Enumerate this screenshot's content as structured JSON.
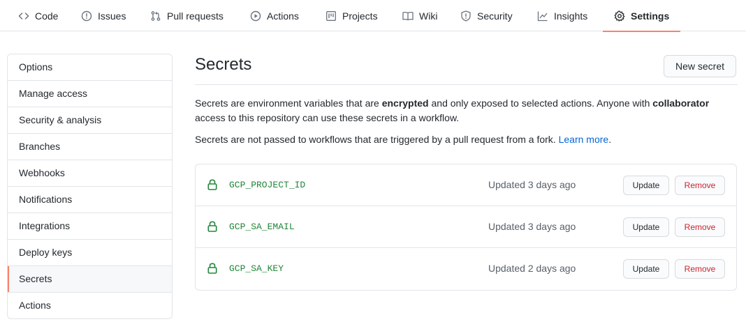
{
  "nav": {
    "tabs": [
      {
        "label": "Code",
        "icon": "code-icon"
      },
      {
        "label": "Issues",
        "icon": "issue-icon"
      },
      {
        "label": "Pull requests",
        "icon": "pull-request-icon"
      },
      {
        "label": "Actions",
        "icon": "play-icon"
      },
      {
        "label": "Projects",
        "icon": "project-icon"
      },
      {
        "label": "Wiki",
        "icon": "book-icon"
      },
      {
        "label": "Security",
        "icon": "shield-icon"
      },
      {
        "label": "Insights",
        "icon": "graph-icon"
      },
      {
        "label": "Settings",
        "icon": "gear-icon"
      }
    ],
    "selected": "Settings"
  },
  "sidebar": {
    "items": [
      {
        "label": "Options"
      },
      {
        "label": "Manage access"
      },
      {
        "label": "Security & analysis"
      },
      {
        "label": "Branches"
      },
      {
        "label": "Webhooks"
      },
      {
        "label": "Notifications"
      },
      {
        "label": "Integrations"
      },
      {
        "label": "Deploy keys"
      },
      {
        "label": "Secrets"
      },
      {
        "label": "Actions"
      }
    ],
    "selected": "Secrets"
  },
  "main": {
    "title": "Secrets",
    "new_button": "New secret",
    "desc1": {
      "a": "Secrets are environment variables that are ",
      "b": "encrypted",
      "c": " and only exposed to selected actions. Anyone with ",
      "d": "collaborator",
      "e": " access to this repository can use these secrets in a workflow."
    },
    "desc2": {
      "a": "Secrets are not passed to workflows that are triggered by a pull request from a fork. ",
      "link": "Learn more",
      "b": "."
    },
    "secrets": [
      {
        "name": "GCP_PROJECT_ID",
        "updated": "Updated 3 days ago",
        "update_label": "Update",
        "remove_label": "Remove"
      },
      {
        "name": "GCP_SA_EMAIL",
        "updated": "Updated 3 days ago",
        "update_label": "Update",
        "remove_label": "Remove"
      },
      {
        "name": "GCP_SA_KEY",
        "updated": "Updated 2 days ago",
        "update_label": "Update",
        "remove_label": "Remove"
      }
    ]
  },
  "colors": {
    "accent_underline": "#f9826c",
    "link": "#0366d6",
    "secret_name": "#22863a",
    "danger": "#cb2431",
    "border": "#e1e4e8"
  }
}
